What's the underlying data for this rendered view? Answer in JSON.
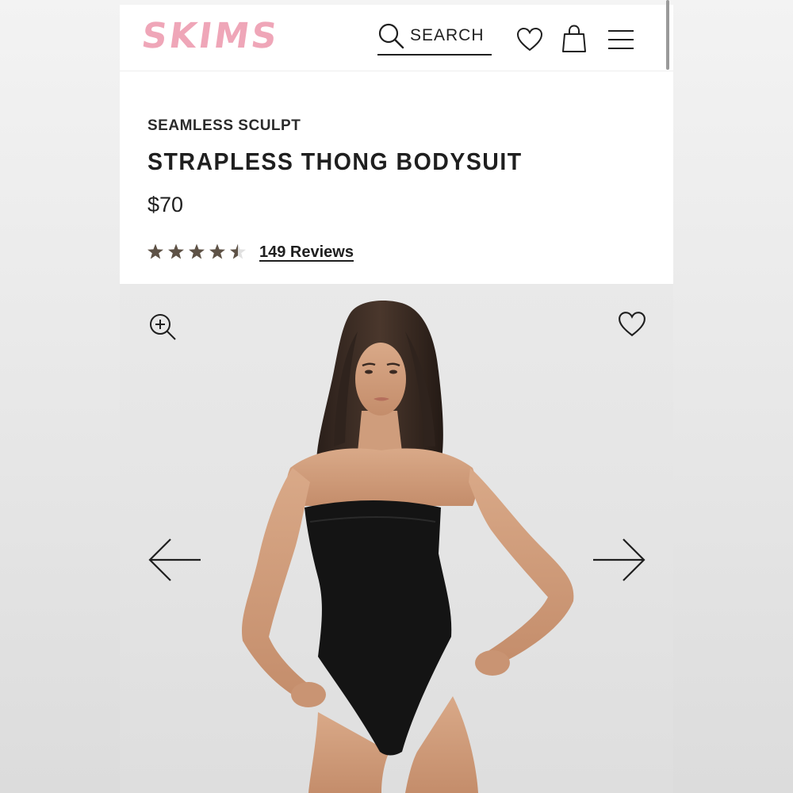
{
  "header": {
    "logo": "SKIMS",
    "search_label": "SEARCH",
    "icons": [
      "search-icon",
      "heart-icon",
      "shopping-bag-icon",
      "menu-icon"
    ]
  },
  "product": {
    "collection": "SEAMLESS SCULPT",
    "title": "STRAPLESS THONG BODYSUIT",
    "price": "$70",
    "rating": 4.5,
    "rating_max": 5,
    "reviews_label": "149 Reviews"
  },
  "gallery": {
    "icons": [
      "zoom-in-icon",
      "heart-icon",
      "arrow-left-icon",
      "arrow-right-icon"
    ]
  },
  "colors": {
    "brand_pink": "#efa6b8",
    "star": "#5e5246",
    "text": "#1f1f1f"
  }
}
